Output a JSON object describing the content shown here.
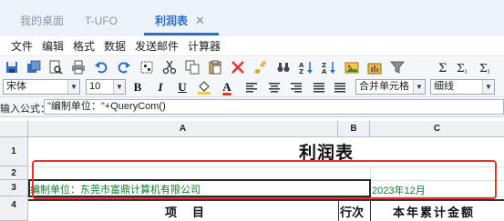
{
  "tabs": [
    {
      "label": "我的桌面",
      "active": false
    },
    {
      "label": "T-UFO",
      "active": false
    },
    {
      "label": "利润表",
      "active": true,
      "close_glyph": "✕"
    }
  ],
  "menu": [
    "文件",
    "编辑",
    "格式",
    "数据",
    "发送邮件",
    "计算器"
  ],
  "toolbar": {
    "icons": [
      "save-icon",
      "save-as-icon",
      "preview-icon",
      "print-icon",
      "undo-icon",
      "redo-icon",
      "select-icon",
      "cut-icon",
      "copy-icon",
      "paste-icon",
      "delete-icon",
      "brush-icon",
      "find-icon",
      "sort-asc-icon",
      "sort-desc-icon",
      "insert-image-icon",
      "insert-chart-icon",
      "filter-icon",
      "sum-icon",
      "sum-row-icon",
      "sum-col-icon"
    ]
  },
  "format": {
    "font_name": "宋体",
    "font_size": "10",
    "bold": "B",
    "italic": "I",
    "underline": "U",
    "font_color": "A",
    "merge": "合并单元格",
    "border": "细线"
  },
  "formula": {
    "label": "输入公式：",
    "value": "\"编制单位：\"+QueryCom()"
  },
  "sheet": {
    "columns": [
      "A",
      "B",
      "C"
    ],
    "rows": [
      "1",
      "2",
      "3",
      "4"
    ],
    "title": "利润表",
    "company": "编制单位：东莞市富鼎计算机有限公司",
    "period": "2023年12月",
    "header_item": "项　目",
    "header_line": "行次",
    "header_ytd": "本年累计金额"
  },
  "colors": {
    "accent": "#2b6fc4",
    "highlight_box": "#e0342c",
    "green_text": "#0d7a2f"
  }
}
